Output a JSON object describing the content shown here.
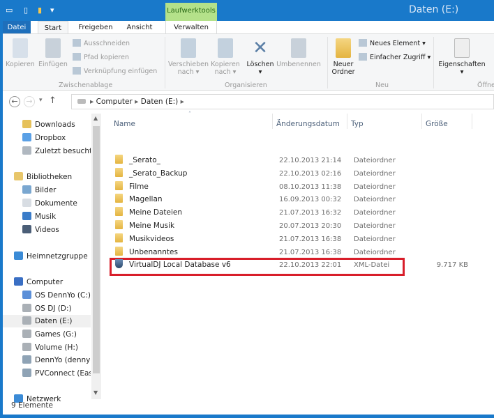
{
  "window": {
    "title": "Daten (E:)",
    "context_tab_group": "Laufwerktools"
  },
  "tabs": [
    "Datei",
    "Start",
    "Freigeben",
    "Ansicht",
    "Verwalten"
  ],
  "ribbon": {
    "clipboard": {
      "copy": "Kopieren",
      "paste": "Einfügen",
      "cut": "Ausschneiden",
      "copy_path": "Pfad kopieren",
      "paste_shortcut": "Verknüpfung einfügen",
      "group": "Zwischenablage"
    },
    "organize": {
      "move_to": [
        "Verschieben",
        "nach ▾"
      ],
      "copy_to": [
        "Kopieren",
        "nach ▾"
      ],
      "delete": "Löschen",
      "delete_arrow": "▾",
      "rename": "Umbenennen",
      "group": "Organisieren"
    },
    "new": {
      "new_folder": [
        "Neuer",
        "Ordner"
      ],
      "new_item": "Neues Element ▾",
      "easy_access": "Einfacher Zugriff ▾",
      "group": "Neu"
    },
    "open": {
      "properties": "Eigenschaften",
      "properties_arrow": "▾",
      "group": "Öffnen"
    }
  },
  "address": {
    "back": "←",
    "forward": "→",
    "recent": "▾",
    "up": "↑",
    "path": [
      "Computer",
      "Daten (E:)"
    ],
    "sep": "▸"
  },
  "nav": [
    {
      "label": "Downloads",
      "icon": "downloads-icon",
      "color": "#e6c15a"
    },
    {
      "label": "Dropbox",
      "icon": "dropbox-icon",
      "color": "#5aa0e6"
    },
    {
      "label": "Zuletzt besucht",
      "icon": "recent-places-icon",
      "color": "#b0b8c0"
    },
    {
      "label": "Bibliotheken",
      "icon": "libraries-icon",
      "color": "#e8c66a"
    },
    {
      "label": "Bilder",
      "icon": "pictures-icon",
      "color": "#7aa7d0"
    },
    {
      "label": "Dokumente",
      "icon": "documents-icon",
      "color": "#d8dde3"
    },
    {
      "label": "Musik",
      "icon": "music-icon",
      "color": "#3a7cc9"
    },
    {
      "label": "Videos",
      "icon": "videos-icon",
      "color": "#4b5e77"
    },
    {
      "label": "Heimnetzgruppe",
      "icon": "homegroup-icon",
      "color": "#3b8bd6"
    },
    {
      "label": "Computer",
      "icon": "computer-icon",
      "color": "#3a6fc4"
    },
    {
      "label": "OS DennYo (C:)",
      "icon": "system-drive-icon",
      "color": "#5b8fd8"
    },
    {
      "label": "OS DJ (D:)",
      "icon": "drive-icon",
      "color": "#aab0b6"
    },
    {
      "label": "Daten (E:)",
      "icon": "drive-icon",
      "color": "#aab0b6"
    },
    {
      "label": "Games (G:)",
      "icon": "drive-icon",
      "color": "#aab0b6"
    },
    {
      "label": "Volume (H:)",
      "icon": "drive-icon",
      "color": "#aab0b6"
    },
    {
      "label": "DennYo (dennyo",
      "icon": "network-drive-icon",
      "color": "#8fa3b5"
    },
    {
      "label": "PVConnect (Easy",
      "icon": "network-drive-icon",
      "color": "#8fa3b5"
    },
    {
      "label": "Netzwerk",
      "icon": "network-icon",
      "color": "#3b8bd6"
    }
  ],
  "columns": [
    "Name",
    "Änderungsdatum",
    "Typ",
    "Größe"
  ],
  "files": [
    {
      "name": "_Serato_",
      "date": "22.10.2013 21:14",
      "type": "Dateiordner",
      "size": ""
    },
    {
      "name": "_Serato_Backup",
      "date": "22.10.2013 02:16",
      "type": "Dateiordner",
      "size": ""
    },
    {
      "name": "Filme",
      "date": "08.10.2013 11:38",
      "type": "Dateiordner",
      "size": ""
    },
    {
      "name": "Magellan",
      "date": "16.09.2013 00:32",
      "type": "Dateiordner",
      "size": ""
    },
    {
      "name": "Meine Dateien",
      "date": "21.07.2013 16:32",
      "type": "Dateiordner",
      "size": ""
    },
    {
      "name": "Meine Musik",
      "date": "20.07.2013 20:30",
      "type": "Dateiordner",
      "size": ""
    },
    {
      "name": "Musikvideos",
      "date": "21.07.2013 16:38",
      "type": "Dateiordner",
      "size": ""
    },
    {
      "name": "Unbenanntes",
      "date": "21.07.2013 16:38",
      "type": "Dateiordner",
      "size": ""
    },
    {
      "name": "VirtualDJ Local Database v6",
      "date": "22.10.2013 22:01",
      "type": "XML-Datei",
      "size": "9.717 KB"
    }
  ],
  "status": "9 Elemente",
  "colors": {
    "accent": "#1979ca",
    "highlight": "#d81e2a",
    "context_tab": "#b4e18a"
  }
}
